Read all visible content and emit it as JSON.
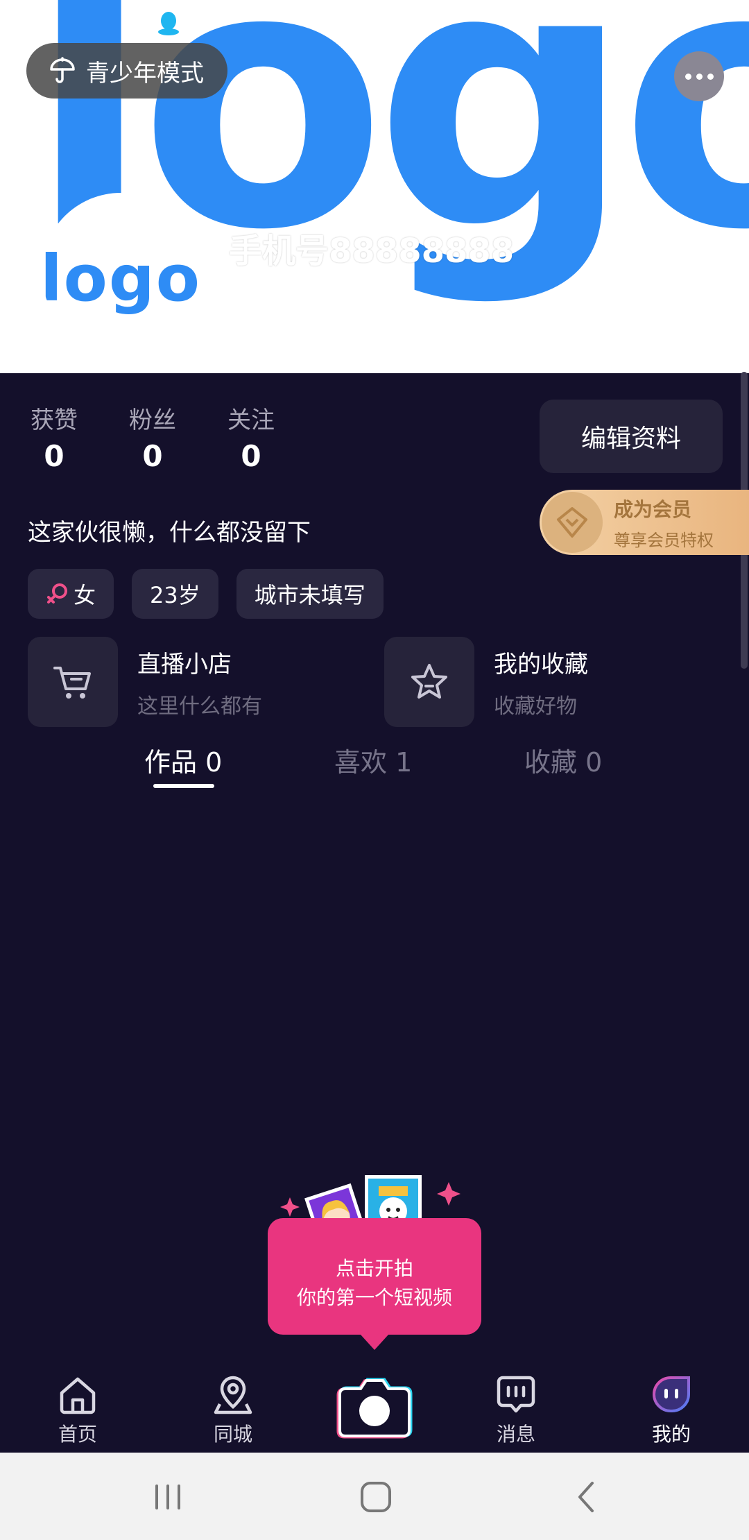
{
  "cover": {
    "logo_text": "logo",
    "avatar_text": "logo",
    "username": "手机号88888888"
  },
  "header": {
    "teen_mode_label": "青少年模式"
  },
  "stats": [
    {
      "label": "获赞",
      "value": "0"
    },
    {
      "label": "粉丝",
      "value": "0"
    },
    {
      "label": "关注",
      "value": "0"
    }
  ],
  "edit_profile_label": "编辑资料",
  "vip": {
    "title": "成为会员",
    "subtitle": "尊享会员特权"
  },
  "bio": "这家伙很懒，什么都没留下",
  "tags": {
    "gender": "女",
    "age": "23岁",
    "city": "城市未填写"
  },
  "features": {
    "shop_title": "直播小店",
    "shop_subtitle": "这里什么都有",
    "fav_title": "我的收藏",
    "fav_subtitle": "收藏好物"
  },
  "tabs": [
    {
      "label": "作品 0",
      "active": true
    },
    {
      "label": "喜欢 1",
      "active": false
    },
    {
      "label": "收藏 0",
      "active": false
    }
  ],
  "shoot_prompt": {
    "line1": "点击开拍",
    "line2": "你的第一个短视频"
  },
  "bottom_nav": {
    "home": "首页",
    "local": "同城",
    "messages": "消息",
    "me": "我的"
  },
  "colors": {
    "accent_blue": "#2e8cf5",
    "background": "#14102b",
    "prompt_pink": "#e9357f",
    "vip_gold": "#e9b57f"
  }
}
